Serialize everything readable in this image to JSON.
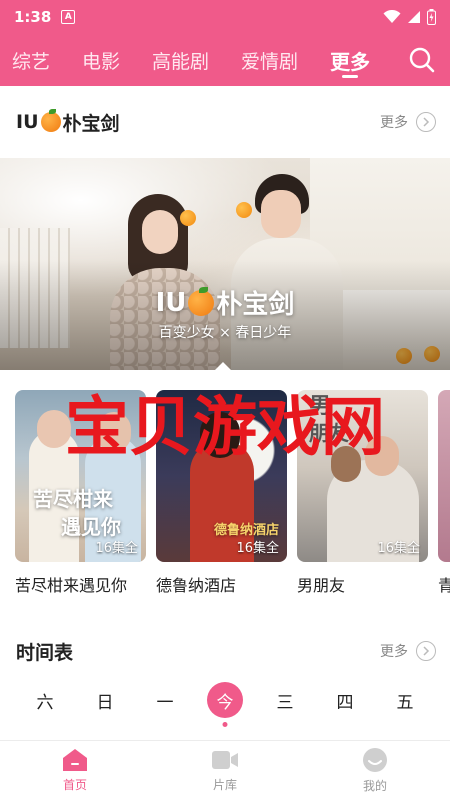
{
  "status_bar": {
    "time": "1:38",
    "notification_letter": "A"
  },
  "top_nav": {
    "tabs": [
      {
        "label": "综艺"
      },
      {
        "label": "电影"
      },
      {
        "label": "高能剧"
      },
      {
        "label": "爱情剧"
      },
      {
        "label": "更多"
      }
    ],
    "active_tab": "更多",
    "icons": {
      "search": "search-icon"
    }
  },
  "section": {
    "title_prefix": "IU",
    "title_suffix": "朴宝剑",
    "more_label": "更多"
  },
  "banner": {
    "title_prefix": "IU",
    "title_suffix": "朴宝剑",
    "subtitle": "百变少女 × 春日少年"
  },
  "posters": [
    {
      "title": "苦尽柑来遇见你",
      "episodes": "16集全",
      "art_line1": "苦尽柑来",
      "art_line2": "遇见你"
    },
    {
      "title": "德鲁纳酒店",
      "episodes": "16集全",
      "art_line1": "德鲁纳酒店",
      "art_line2": ""
    },
    {
      "title": "男朋友",
      "episodes": "16集全",
      "art_line1": "男",
      "art_line2": "朋友"
    },
    {
      "title": "青",
      "episodes": "",
      "art_line1": "",
      "art_line2": ""
    }
  ],
  "watermark": "宝贝游戏网",
  "schedule": {
    "title": "时间表",
    "more_label": "更多",
    "days": [
      "六",
      "日",
      "一",
      "今",
      "三",
      "四",
      "五"
    ],
    "today_index": 3
  },
  "bottom_nav": {
    "items": [
      {
        "label": "首页",
        "icon": "home-icon"
      },
      {
        "label": "片库",
        "icon": "video-library-icon"
      },
      {
        "label": "我的",
        "icon": "profile-icon"
      }
    ],
    "active_index": 0
  },
  "colors": {
    "brand_pink": "#f05a8a",
    "watermark_red": "#e8181e"
  }
}
